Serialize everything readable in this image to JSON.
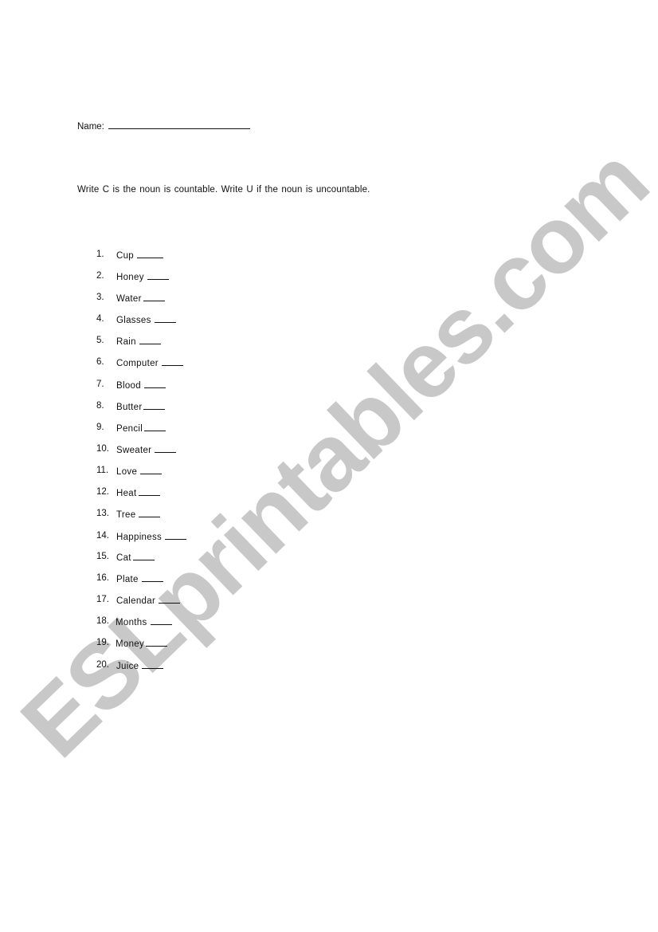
{
  "watermark": {
    "text": "ESLprintables.com",
    "color": "#c8c8c8"
  },
  "worksheet": {
    "name_label": "Name:",
    "instructions": "Write C is the noun is countable. Write U if the noun is uncountable.",
    "items": [
      {
        "number": "1.",
        "word": "Cup"
      },
      {
        "number": "2.",
        "word": "Honey"
      },
      {
        "number": "3.",
        "word": "Water"
      },
      {
        "number": "4.",
        "word": "Glasses"
      },
      {
        "number": "5.",
        "word": "Rain"
      },
      {
        "number": "6.",
        "word": "Computer"
      },
      {
        "number": "7.",
        "word": "Blood"
      },
      {
        "number": "8.",
        "word": "Butter"
      },
      {
        "number": "9.",
        "word": "Pencil"
      },
      {
        "number": "10.",
        "word": "Sweater"
      },
      {
        "number": "11.",
        "word": "Love"
      },
      {
        "number": "12.",
        "word": "Heat"
      },
      {
        "number": "13.",
        "word": "Tree"
      },
      {
        "number": "14.",
        "word": "Happiness"
      },
      {
        "number": "15.",
        "word": "Cat"
      },
      {
        "number": "16.",
        "word": "Plate"
      },
      {
        "number": "17.",
        "word": "Calendar"
      },
      {
        "number": "18.",
        "word": "Months"
      },
      {
        "number": "19.",
        "word": "Money"
      },
      {
        "number": "20.",
        "word": "Juice"
      }
    ]
  }
}
